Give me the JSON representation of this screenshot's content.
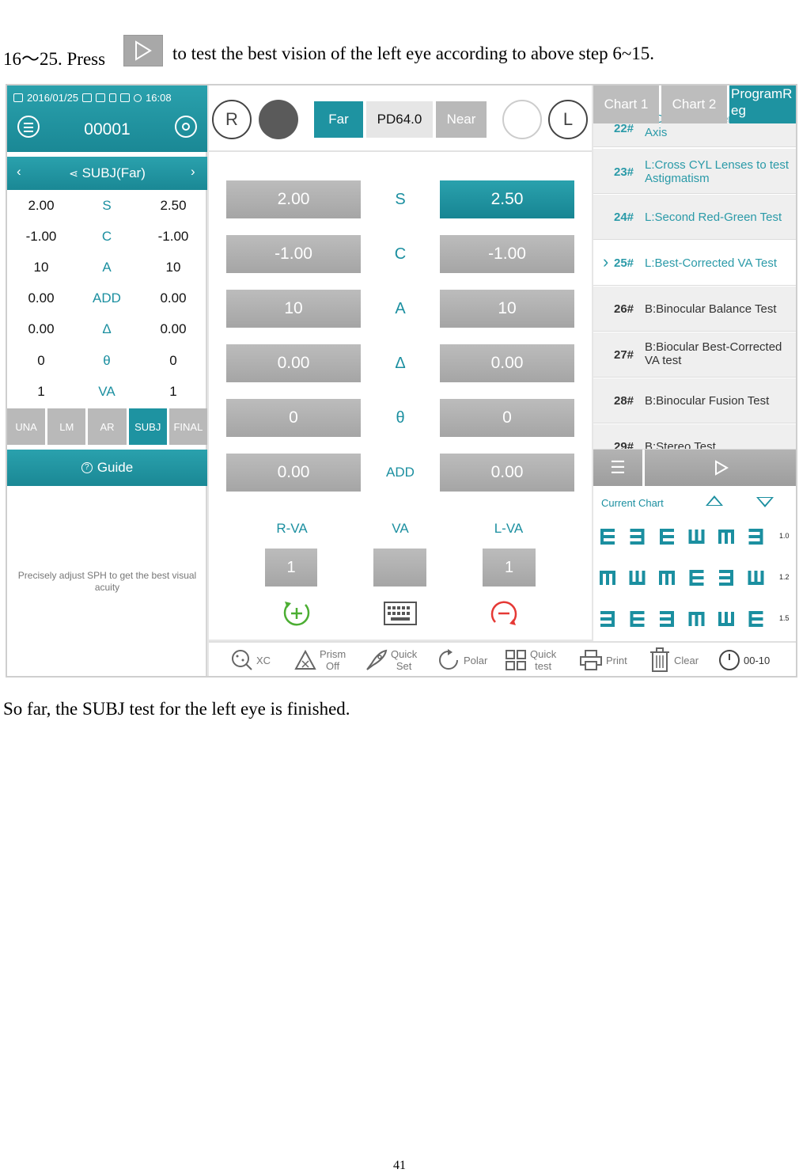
{
  "doc": {
    "line1_prefix": "16～25. Press",
    "line1_suffix": "to test the best vision of the left eye according to above step 6~15.",
    "line2": "So far, the SUBJ test for the left eye is finished.",
    "page_number": "41"
  },
  "status": {
    "date": "2016/01/25",
    "time": "16:08"
  },
  "header": {
    "patient_id": "00001"
  },
  "subj": {
    "title": "SUBJ(Far)"
  },
  "left_table": [
    {
      "r": "2.00",
      "label": "S",
      "l": "2.50"
    },
    {
      "r": "-1.00",
      "label": "C",
      "l": "-1.00"
    },
    {
      "r": "10",
      "label": "A",
      "l": "10"
    },
    {
      "r": "0.00",
      "label": "ADD",
      "l": "0.00"
    },
    {
      "r": "0.00",
      "label": "Δ",
      "l": "0.00"
    },
    {
      "r": "0",
      "label": "θ",
      "l": "0"
    },
    {
      "r": "1",
      "label": "VA",
      "l": "1"
    }
  ],
  "modes": [
    "UNA",
    "LM",
    "AR",
    "SUBJ",
    "FINAL"
  ],
  "guide": {
    "label": "Guide",
    "text": "Precisely adjust SPH to get the best visual acuity"
  },
  "eye": {
    "right": "R",
    "left": "L"
  },
  "distance": {
    "far": "Far",
    "pd": "PD64.0",
    "near": "Near"
  },
  "params": [
    {
      "label": "S",
      "r": "2.00",
      "l": "2.50"
    },
    {
      "label": "C",
      "r": "-1.00",
      "l": "-1.00"
    },
    {
      "label": "A",
      "r": "10",
      "l": "10"
    },
    {
      "label": "Δ",
      "r": "0.00",
      "l": "0.00"
    },
    {
      "label": "θ",
      "r": "0",
      "l": "0"
    },
    {
      "label": "ADD",
      "r": "0.00",
      "l": "0.00"
    }
  ],
  "va": {
    "r_label": "R-VA",
    "label": "VA",
    "l_label": "L-VA",
    "r": "1",
    "center": "",
    "l": "1"
  },
  "chart_tabs": [
    "Chart 1",
    "Chart 2",
    "ProgramReg"
  ],
  "program": [
    {
      "num": "22#",
      "text": "L:Cross CYL Lenses to test Axis"
    },
    {
      "num": "23#",
      "text": "L:Cross CYL Lenses to test Astigmatism"
    },
    {
      "num": "24#",
      "text": "L:Second Red-Green Test"
    },
    {
      "num": "25#",
      "text": "L:Best-Corrected VA Test"
    },
    {
      "num": "26#",
      "text": "B:Binocular Balance Test"
    },
    {
      "num": "27#",
      "text": "B:Biocular Best-Corrected VA test"
    },
    {
      "num": "28#",
      "text": "B:Binocular Fusion Test"
    },
    {
      "num": "29#",
      "text": "B:Stereo Test"
    }
  ],
  "current_chart": {
    "label": "Current Chart",
    "rows": [
      {
        "symbols": "right,left,right,up,down,left",
        "acuity": "1.0"
      },
      {
        "symbols": "down,up,down,right,left,up",
        "acuity": "1.2"
      },
      {
        "symbols": "left,right,left,down,up,right",
        "acuity": "1.5"
      }
    ]
  },
  "toolbar": {
    "xc": "XC",
    "prism": [
      "Prism",
      "Off"
    ],
    "quick_set": [
      "Quick",
      "Set"
    ],
    "polar": "Polar",
    "quick_test": [
      "Quick",
      "test"
    ],
    "print": "Print",
    "clear": "Clear",
    "timer": "00-10"
  },
  "colors": {
    "teal": "#1e93a1",
    "gray_button": "#b0b0b0",
    "label_teal": "#1b8fa0",
    "accent_green": "#4cae33",
    "accent_red": "#e53935"
  }
}
